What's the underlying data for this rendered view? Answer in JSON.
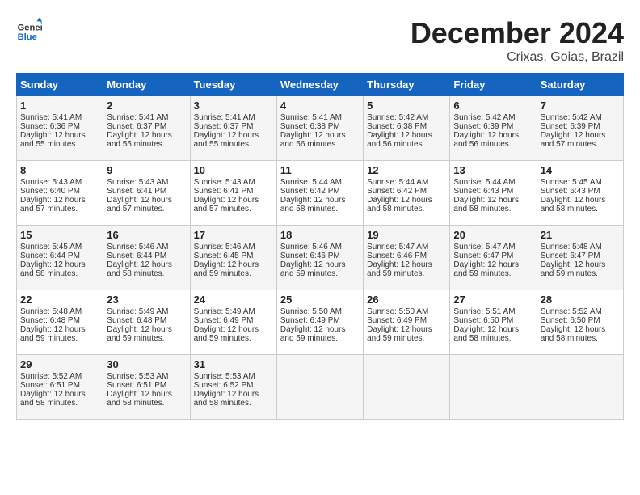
{
  "logo": {
    "line1": "General",
    "line2": "Blue"
  },
  "title": "December 2024",
  "subtitle": "Crixas, Goias, Brazil",
  "days_of_week": [
    "Sunday",
    "Monday",
    "Tuesday",
    "Wednesday",
    "Thursday",
    "Friday",
    "Saturday"
  ],
  "weeks": [
    [
      {
        "day": "1",
        "sunrise": "Sunrise: 5:41 AM",
        "sunset": "Sunset: 6:36 PM",
        "daylight": "Daylight: 12 hours and 55 minutes."
      },
      {
        "day": "2",
        "sunrise": "Sunrise: 5:41 AM",
        "sunset": "Sunset: 6:37 PM",
        "daylight": "Daylight: 12 hours and 55 minutes."
      },
      {
        "day": "3",
        "sunrise": "Sunrise: 5:41 AM",
        "sunset": "Sunset: 6:37 PM",
        "daylight": "Daylight: 12 hours and 55 minutes."
      },
      {
        "day": "4",
        "sunrise": "Sunrise: 5:41 AM",
        "sunset": "Sunset: 6:38 PM",
        "daylight": "Daylight: 12 hours and 56 minutes."
      },
      {
        "day": "5",
        "sunrise": "Sunrise: 5:42 AM",
        "sunset": "Sunset: 6:38 PM",
        "daylight": "Daylight: 12 hours and 56 minutes."
      },
      {
        "day": "6",
        "sunrise": "Sunrise: 5:42 AM",
        "sunset": "Sunset: 6:39 PM",
        "daylight": "Daylight: 12 hours and 56 minutes."
      },
      {
        "day": "7",
        "sunrise": "Sunrise: 5:42 AM",
        "sunset": "Sunset: 6:39 PM",
        "daylight": "Daylight: 12 hours and 57 minutes."
      }
    ],
    [
      {
        "day": "8",
        "sunrise": "Sunrise: 5:43 AM",
        "sunset": "Sunset: 6:40 PM",
        "daylight": "Daylight: 12 hours and 57 minutes."
      },
      {
        "day": "9",
        "sunrise": "Sunrise: 5:43 AM",
        "sunset": "Sunset: 6:41 PM",
        "daylight": "Daylight: 12 hours and 57 minutes."
      },
      {
        "day": "10",
        "sunrise": "Sunrise: 5:43 AM",
        "sunset": "Sunset: 6:41 PM",
        "daylight": "Daylight: 12 hours and 57 minutes."
      },
      {
        "day": "11",
        "sunrise": "Sunrise: 5:44 AM",
        "sunset": "Sunset: 6:42 PM",
        "daylight": "Daylight: 12 hours and 58 minutes."
      },
      {
        "day": "12",
        "sunrise": "Sunrise: 5:44 AM",
        "sunset": "Sunset: 6:42 PM",
        "daylight": "Daylight: 12 hours and 58 minutes."
      },
      {
        "day": "13",
        "sunrise": "Sunrise: 5:44 AM",
        "sunset": "Sunset: 6:43 PM",
        "daylight": "Daylight: 12 hours and 58 minutes."
      },
      {
        "day": "14",
        "sunrise": "Sunrise: 5:45 AM",
        "sunset": "Sunset: 6:43 PM",
        "daylight": "Daylight: 12 hours and 58 minutes."
      }
    ],
    [
      {
        "day": "15",
        "sunrise": "Sunrise: 5:45 AM",
        "sunset": "Sunset: 6:44 PM",
        "daylight": "Daylight: 12 hours and 58 minutes."
      },
      {
        "day": "16",
        "sunrise": "Sunrise: 5:46 AM",
        "sunset": "Sunset: 6:44 PM",
        "daylight": "Daylight: 12 hours and 58 minutes."
      },
      {
        "day": "17",
        "sunrise": "Sunrise: 5:46 AM",
        "sunset": "Sunset: 6:45 PM",
        "daylight": "Daylight: 12 hours and 59 minutes."
      },
      {
        "day": "18",
        "sunrise": "Sunrise: 5:46 AM",
        "sunset": "Sunset: 6:46 PM",
        "daylight": "Daylight: 12 hours and 59 minutes."
      },
      {
        "day": "19",
        "sunrise": "Sunrise: 5:47 AM",
        "sunset": "Sunset: 6:46 PM",
        "daylight": "Daylight: 12 hours and 59 minutes."
      },
      {
        "day": "20",
        "sunrise": "Sunrise: 5:47 AM",
        "sunset": "Sunset: 6:47 PM",
        "daylight": "Daylight: 12 hours and 59 minutes."
      },
      {
        "day": "21",
        "sunrise": "Sunrise: 5:48 AM",
        "sunset": "Sunset: 6:47 PM",
        "daylight": "Daylight: 12 hours and 59 minutes."
      }
    ],
    [
      {
        "day": "22",
        "sunrise": "Sunrise: 5:48 AM",
        "sunset": "Sunset: 6:48 PM",
        "daylight": "Daylight: 12 hours and 59 minutes."
      },
      {
        "day": "23",
        "sunrise": "Sunrise: 5:49 AM",
        "sunset": "Sunset: 6:48 PM",
        "daylight": "Daylight: 12 hours and 59 minutes."
      },
      {
        "day": "24",
        "sunrise": "Sunrise: 5:49 AM",
        "sunset": "Sunset: 6:49 PM",
        "daylight": "Daylight: 12 hours and 59 minutes."
      },
      {
        "day": "25",
        "sunrise": "Sunrise: 5:50 AM",
        "sunset": "Sunset: 6:49 PM",
        "daylight": "Daylight: 12 hours and 59 minutes."
      },
      {
        "day": "26",
        "sunrise": "Sunrise: 5:50 AM",
        "sunset": "Sunset: 6:49 PM",
        "daylight": "Daylight: 12 hours and 59 minutes."
      },
      {
        "day": "27",
        "sunrise": "Sunrise: 5:51 AM",
        "sunset": "Sunset: 6:50 PM",
        "daylight": "Daylight: 12 hours and 58 minutes."
      },
      {
        "day": "28",
        "sunrise": "Sunrise: 5:52 AM",
        "sunset": "Sunset: 6:50 PM",
        "daylight": "Daylight: 12 hours and 58 minutes."
      }
    ],
    [
      {
        "day": "29",
        "sunrise": "Sunrise: 5:52 AM",
        "sunset": "Sunset: 6:51 PM",
        "daylight": "Daylight: 12 hours and 58 minutes."
      },
      {
        "day": "30",
        "sunrise": "Sunrise: 5:53 AM",
        "sunset": "Sunset: 6:51 PM",
        "daylight": "Daylight: 12 hours and 58 minutes."
      },
      {
        "day": "31",
        "sunrise": "Sunrise: 5:53 AM",
        "sunset": "Sunset: 6:52 PM",
        "daylight": "Daylight: 12 hours and 58 minutes."
      },
      null,
      null,
      null,
      null
    ]
  ]
}
